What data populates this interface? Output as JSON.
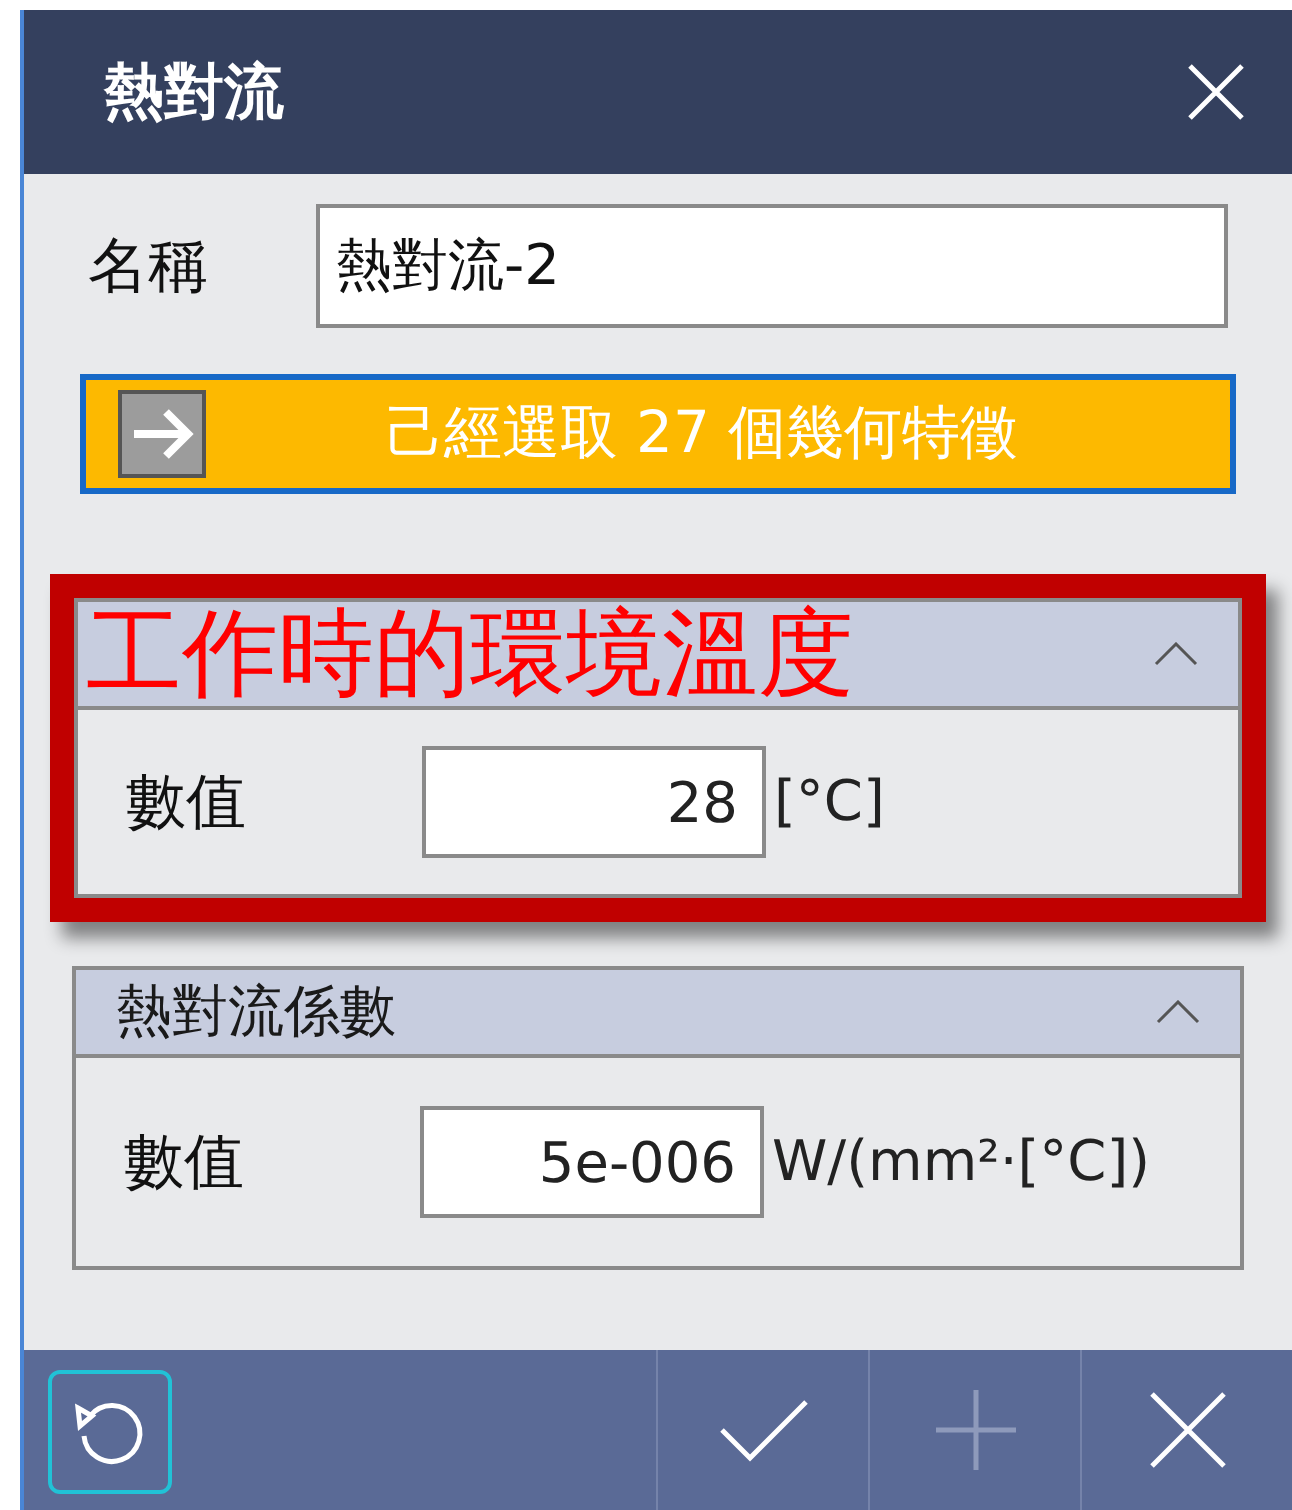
{
  "window": {
    "title": "熱對流"
  },
  "name_field": {
    "label": "名稱",
    "value": "熱對流-2"
  },
  "selection_button": {
    "label": "己經選取 27 個幾何特徵"
  },
  "sections": [
    {
      "expanded": true,
      "field": {
        "label": "數值",
        "value": "28",
        "unit": "[°C]"
      },
      "annotation": "工作時的環境溫度"
    },
    {
      "title": "熱對流係數",
      "expanded": true,
      "field": {
        "label": "數值",
        "value": "5e-006",
        "unit": "W/(mm²·[°C])"
      }
    }
  ],
  "footer": {
    "buttons": [
      {
        "kind": "reset",
        "disabled": false
      },
      {
        "kind": "confirm",
        "disabled": false
      },
      {
        "kind": "add",
        "disabled": true
      },
      {
        "kind": "cancel",
        "disabled": false
      }
    ]
  }
}
